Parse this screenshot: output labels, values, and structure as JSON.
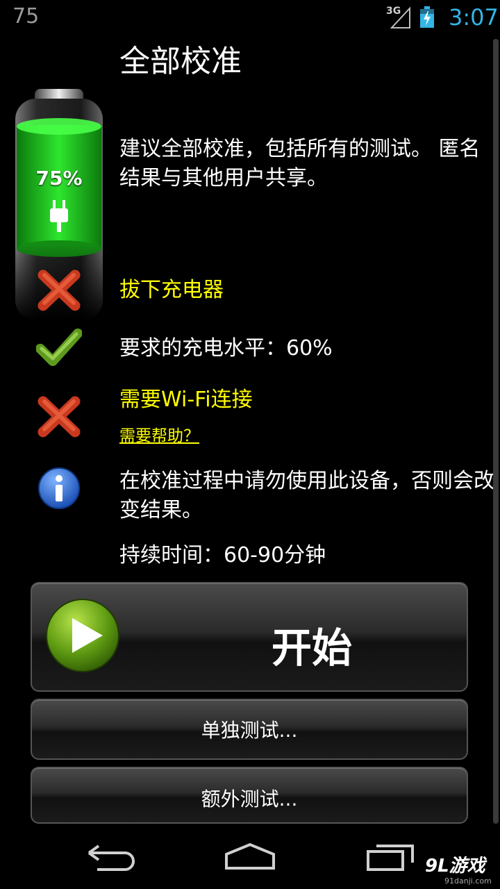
{
  "status_bar": {
    "left_text": "75",
    "network": "3G",
    "time": "3:07",
    "accent_color": "#33b5e5"
  },
  "battery": {
    "level_text": "75%",
    "icon": "charging-plug-icon"
  },
  "page": {
    "title": "全部校准",
    "description": "建议全部校准，包括所有的测试。 匿名结果与其他用户共享。"
  },
  "requirements": [
    {
      "icon": "red-x-icon",
      "text": "拔下充电器",
      "color": "#ffff00"
    },
    {
      "icon": "green-check-icon",
      "text": "要求的充电水平：60%",
      "color": "#ffffff"
    },
    {
      "icon": "red-x-icon",
      "text": "需要Wi-Fi连接",
      "color": "#ffff00"
    }
  ],
  "help_link": "需要帮助？",
  "warning": {
    "icon": "info-icon",
    "text": "在校准过程中请勿使用此设备，否则会改变结果。"
  },
  "duration": "持续时间：60-90分钟",
  "buttons": {
    "start": "开始",
    "single_test": "单独测试...",
    "extra_test": "额外测试..."
  },
  "watermark": {
    "logo": "9L游戏",
    "site": "91danji.com"
  }
}
